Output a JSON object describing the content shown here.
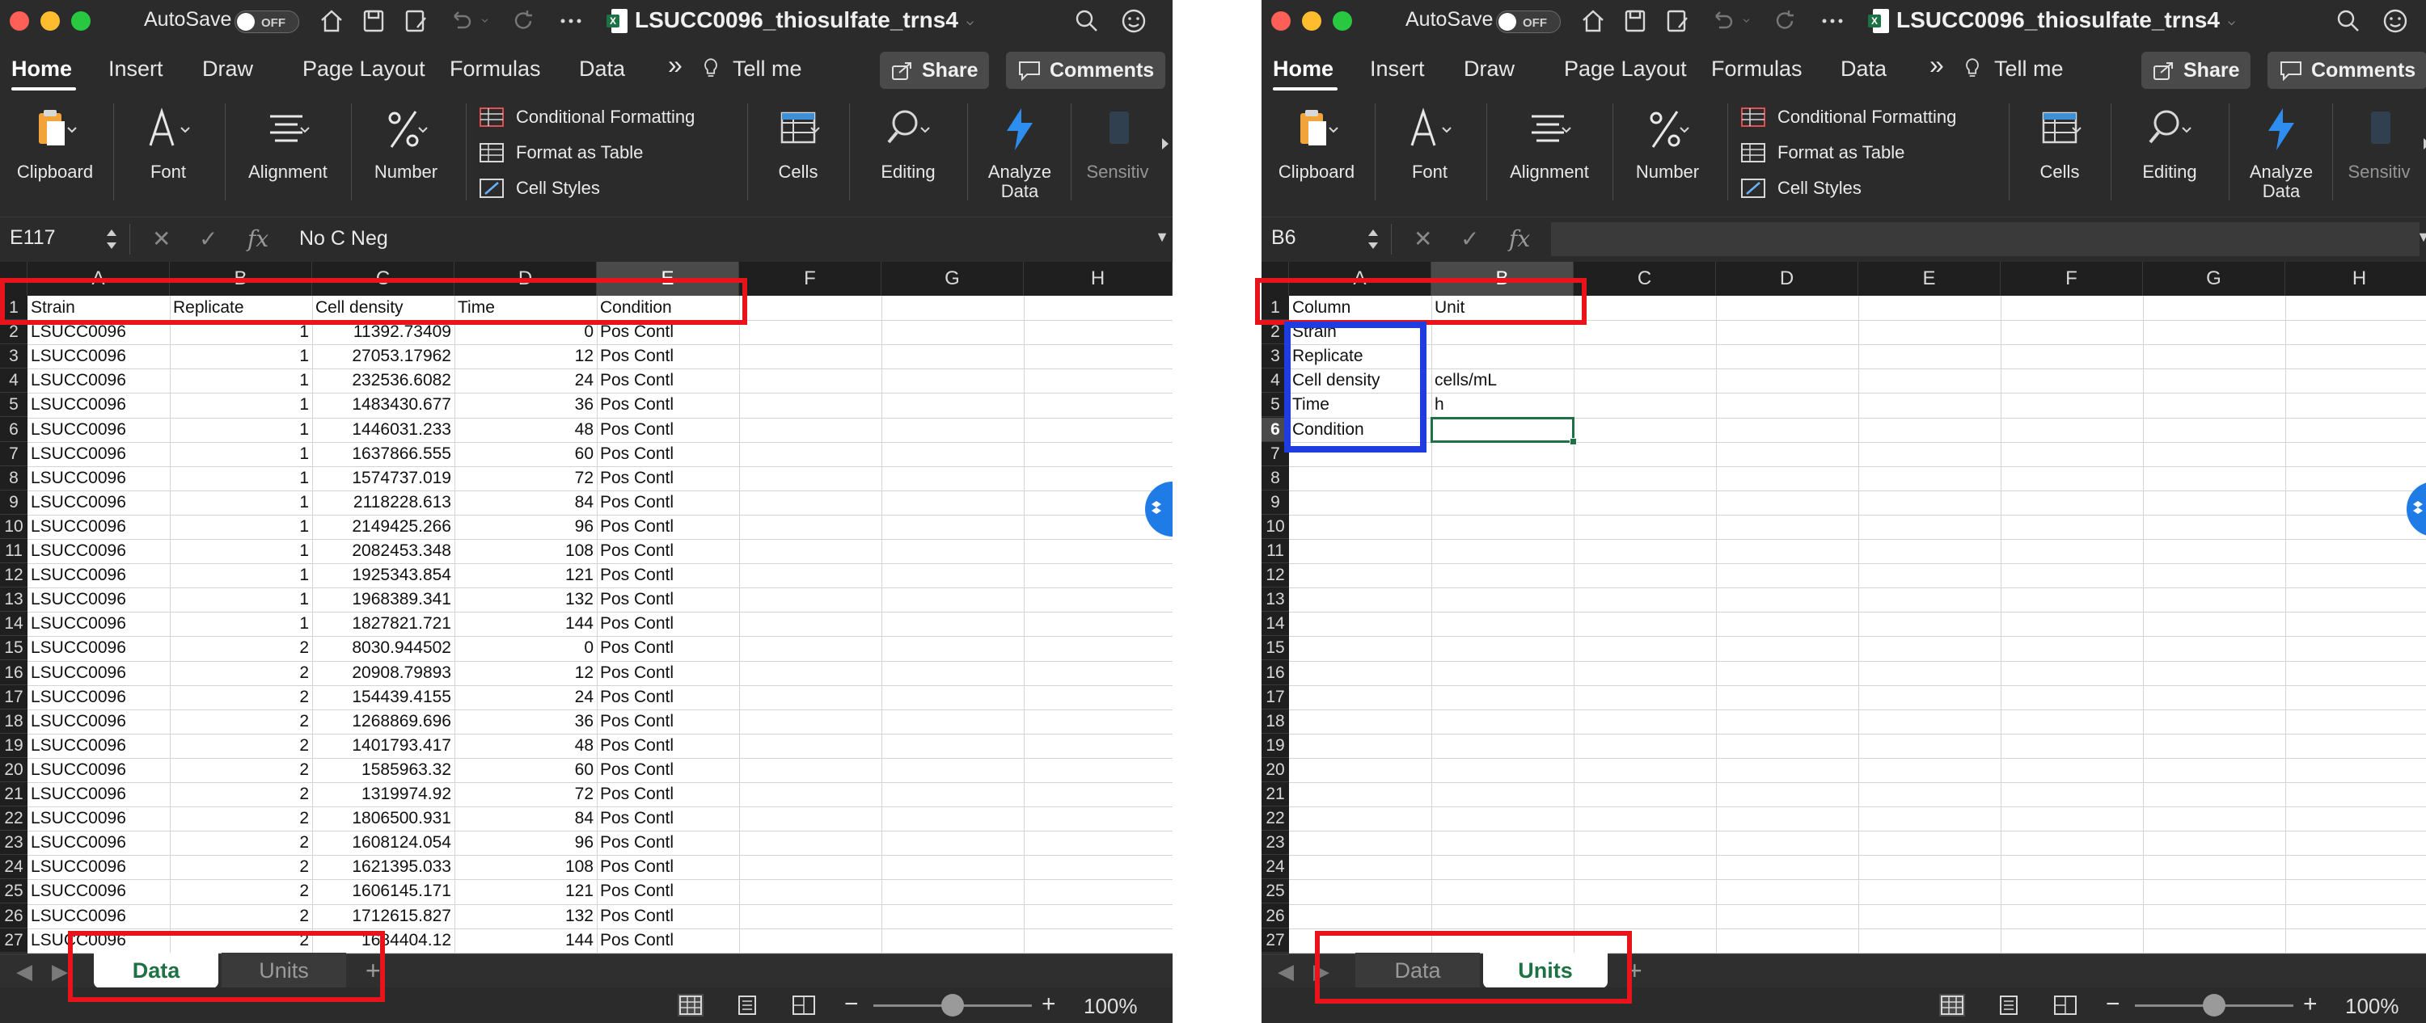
{
  "colors": {
    "accent_green": "#1e7145",
    "highlight_red": "#e8141c",
    "highlight_blue": "#1f3ce0",
    "app_chrome": "#2b2b2b"
  },
  "app": {
    "autosave_label": "AutoSave",
    "autosave_state": "OFF",
    "doc_title": "LSUCC0096_thiosulfate_trns4"
  },
  "ribbon": {
    "tabs": [
      "Home",
      "Insert",
      "Draw",
      "Page Layout",
      "Formulas",
      "Data"
    ],
    "more": "»",
    "tell_me": "Tell me",
    "share": "Share",
    "comments": "Comments",
    "groups": {
      "clipboard": "Clipboard",
      "font": "Font",
      "alignment": "Alignment",
      "number": "Number",
      "conditional_formatting": "Conditional Formatting",
      "format_as_table": "Format as Table",
      "cell_styles": "Cell Styles",
      "cells": "Cells",
      "editing": "Editing",
      "analyze_data_1": "Analyze",
      "analyze_data_2": "Data",
      "sensitivity": "Sensitiv"
    },
    "icons": [
      "clipboard-icon",
      "font-icon",
      "alignment-icon",
      "percent-icon",
      "conditional-formatting-icon",
      "table-icon",
      "cell-styles-icon",
      "cells-icon",
      "search-icon",
      "lightning-icon"
    ]
  },
  "statusbar": {
    "zoom": "100%",
    "zoom_level_fraction": 0.5
  },
  "left": {
    "name_box": "E117",
    "formula": "No C Neg",
    "columns": [
      "A",
      "B",
      "C",
      "D",
      "E",
      "F",
      "G",
      "H"
    ],
    "selected_column": "E",
    "row_numbers": [
      "1",
      "2",
      "3",
      "4",
      "5",
      "6",
      "7",
      "8",
      "9",
      "10",
      "11",
      "12",
      "13",
      "14",
      "15",
      "16",
      "17",
      "18",
      "19",
      "20",
      "21",
      "22",
      "23",
      "24",
      "25",
      "26",
      "27"
    ],
    "header": [
      "Strain",
      "Replicate",
      "Cell density",
      "Time",
      "Condition"
    ],
    "rows": [
      [
        "LSUCC0096",
        "1",
        "11392.73409",
        "0",
        "Pos Contl"
      ],
      [
        "LSUCC0096",
        "1",
        "27053.17962",
        "12",
        "Pos Contl"
      ],
      [
        "LSUCC0096",
        "1",
        "232536.6082",
        "24",
        "Pos Contl"
      ],
      [
        "LSUCC0096",
        "1",
        "1483430.677",
        "36",
        "Pos Contl"
      ],
      [
        "LSUCC0096",
        "1",
        "1446031.233",
        "48",
        "Pos Contl"
      ],
      [
        "LSUCC0096",
        "1",
        "1637866.555",
        "60",
        "Pos Contl"
      ],
      [
        "LSUCC0096",
        "1",
        "1574737.019",
        "72",
        "Pos Contl"
      ],
      [
        "LSUCC0096",
        "1",
        "2118228.613",
        "84",
        "Pos Contl"
      ],
      [
        "LSUCC0096",
        "1",
        "2149425.266",
        "96",
        "Pos Contl"
      ],
      [
        "LSUCC0096",
        "1",
        "2082453.348",
        "108",
        "Pos Contl"
      ],
      [
        "LSUCC0096",
        "1",
        "1925343.854",
        "121",
        "Pos Contl"
      ],
      [
        "LSUCC0096",
        "1",
        "1968389.341",
        "132",
        "Pos Contl"
      ],
      [
        "LSUCC0096",
        "1",
        "1827821.721",
        "144",
        "Pos Contl"
      ],
      [
        "LSUCC0096",
        "2",
        "8030.944502",
        "0",
        "Pos Contl"
      ],
      [
        "LSUCC0096",
        "2",
        "20908.79893",
        "12",
        "Pos Contl"
      ],
      [
        "LSUCC0096",
        "2",
        "154439.4155",
        "24",
        "Pos Contl"
      ],
      [
        "LSUCC0096",
        "2",
        "1268869.696",
        "36",
        "Pos Contl"
      ],
      [
        "LSUCC0096",
        "2",
        "1401793.417",
        "48",
        "Pos Contl"
      ],
      [
        "LSUCC0096",
        "2",
        "1585963.32",
        "60",
        "Pos Contl"
      ],
      [
        "LSUCC0096",
        "2",
        "1319974.92",
        "72",
        "Pos Contl"
      ],
      [
        "LSUCC0096",
        "2",
        "1806500.931",
        "84",
        "Pos Contl"
      ],
      [
        "LSUCC0096",
        "2",
        "1608124.054",
        "96",
        "Pos Contl"
      ],
      [
        "LSUCC0096",
        "2",
        "1621395.033",
        "108",
        "Pos Contl"
      ],
      [
        "LSUCC0096",
        "2",
        "1606145.171",
        "121",
        "Pos Contl"
      ],
      [
        "LSUCC0096",
        "2",
        "1712615.827",
        "132",
        "Pos Contl"
      ],
      [
        "LSUCC0096",
        "2",
        "1684404.12",
        "144",
        "Pos Contl"
      ]
    ],
    "sheets": [
      "Data",
      "Units"
    ],
    "active_sheet": "Data"
  },
  "right": {
    "name_box": "B6",
    "formula": "",
    "columns": [
      "A",
      "B",
      "C",
      "D",
      "E",
      "F",
      "G",
      "H"
    ],
    "selected_column": "B",
    "row_numbers": [
      "1",
      "2",
      "3",
      "4",
      "5",
      "6",
      "7",
      "8",
      "9",
      "10",
      "11",
      "12",
      "13",
      "14",
      "15",
      "16",
      "17",
      "18",
      "19",
      "20",
      "21",
      "22",
      "23",
      "24",
      "25",
      "26",
      "27"
    ],
    "header": [
      "Column",
      "Unit"
    ],
    "rows": [
      [
        "Strain",
        ""
      ],
      [
        "Replicate",
        ""
      ],
      [
        "Cell density",
        "cells/mL"
      ],
      [
        "Time",
        "h"
      ],
      [
        "Condition",
        ""
      ]
    ],
    "sheets": [
      "Data",
      "Units"
    ],
    "active_sheet": "Units"
  }
}
